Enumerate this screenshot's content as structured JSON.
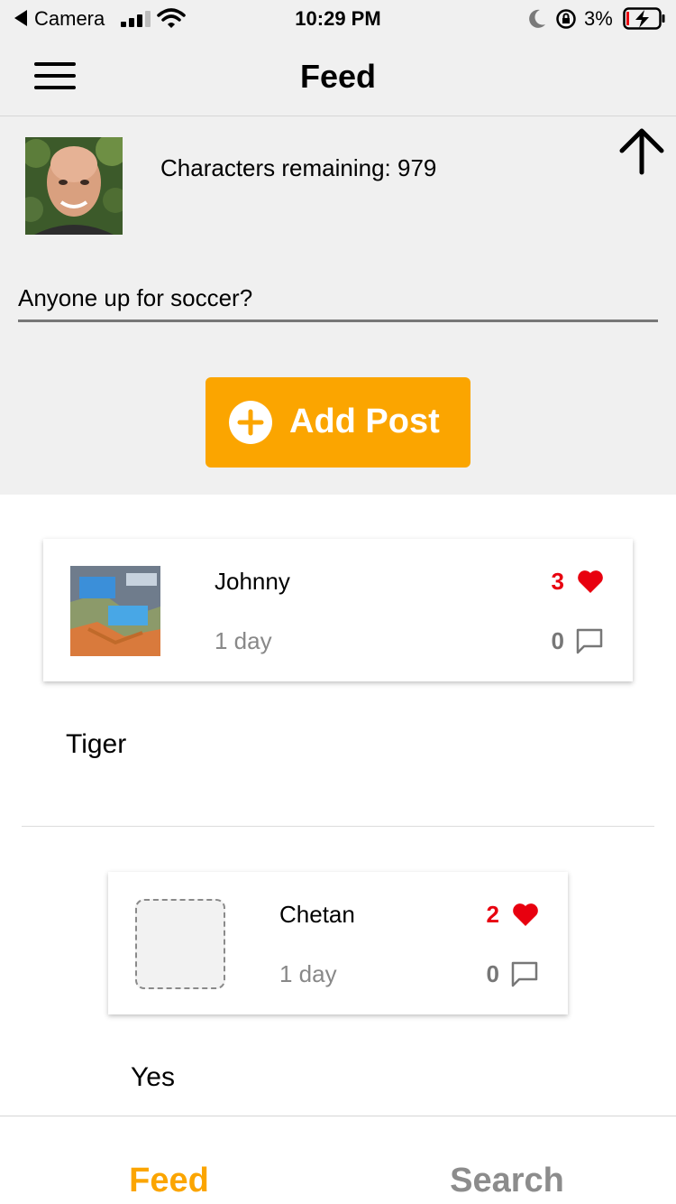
{
  "status_bar": {
    "carrier": "Camera",
    "time": "10:29 PM",
    "battery": "3%"
  },
  "nav": {
    "title": "Feed"
  },
  "composer": {
    "characters_remaining": "Characters remaining: 979",
    "post_text": "Anyone up for soccer?",
    "add_post_label": "Add Post"
  },
  "posts": [
    {
      "author": "Johnny",
      "age": "1 day",
      "likes": "3",
      "comments": "0",
      "body": "Tiger"
    },
    {
      "author": "Chetan",
      "age": "1 day",
      "likes": "2",
      "comments": "0",
      "body": "Yes"
    }
  ],
  "tabs": {
    "feed": "Feed",
    "search": "Search"
  },
  "colors": {
    "accent": "#fba500",
    "like": "#e8000f",
    "header_bg": "#f0f0f0"
  },
  "icons": [
    "back-arrow-icon",
    "cellular-signal-icon",
    "wifi-icon",
    "moon-icon",
    "rotation-lock-icon",
    "battery-charging-icon",
    "hamburger-menu-icon",
    "arrow-up-icon",
    "plus-circle-icon",
    "heart-icon",
    "comment-icon"
  ]
}
